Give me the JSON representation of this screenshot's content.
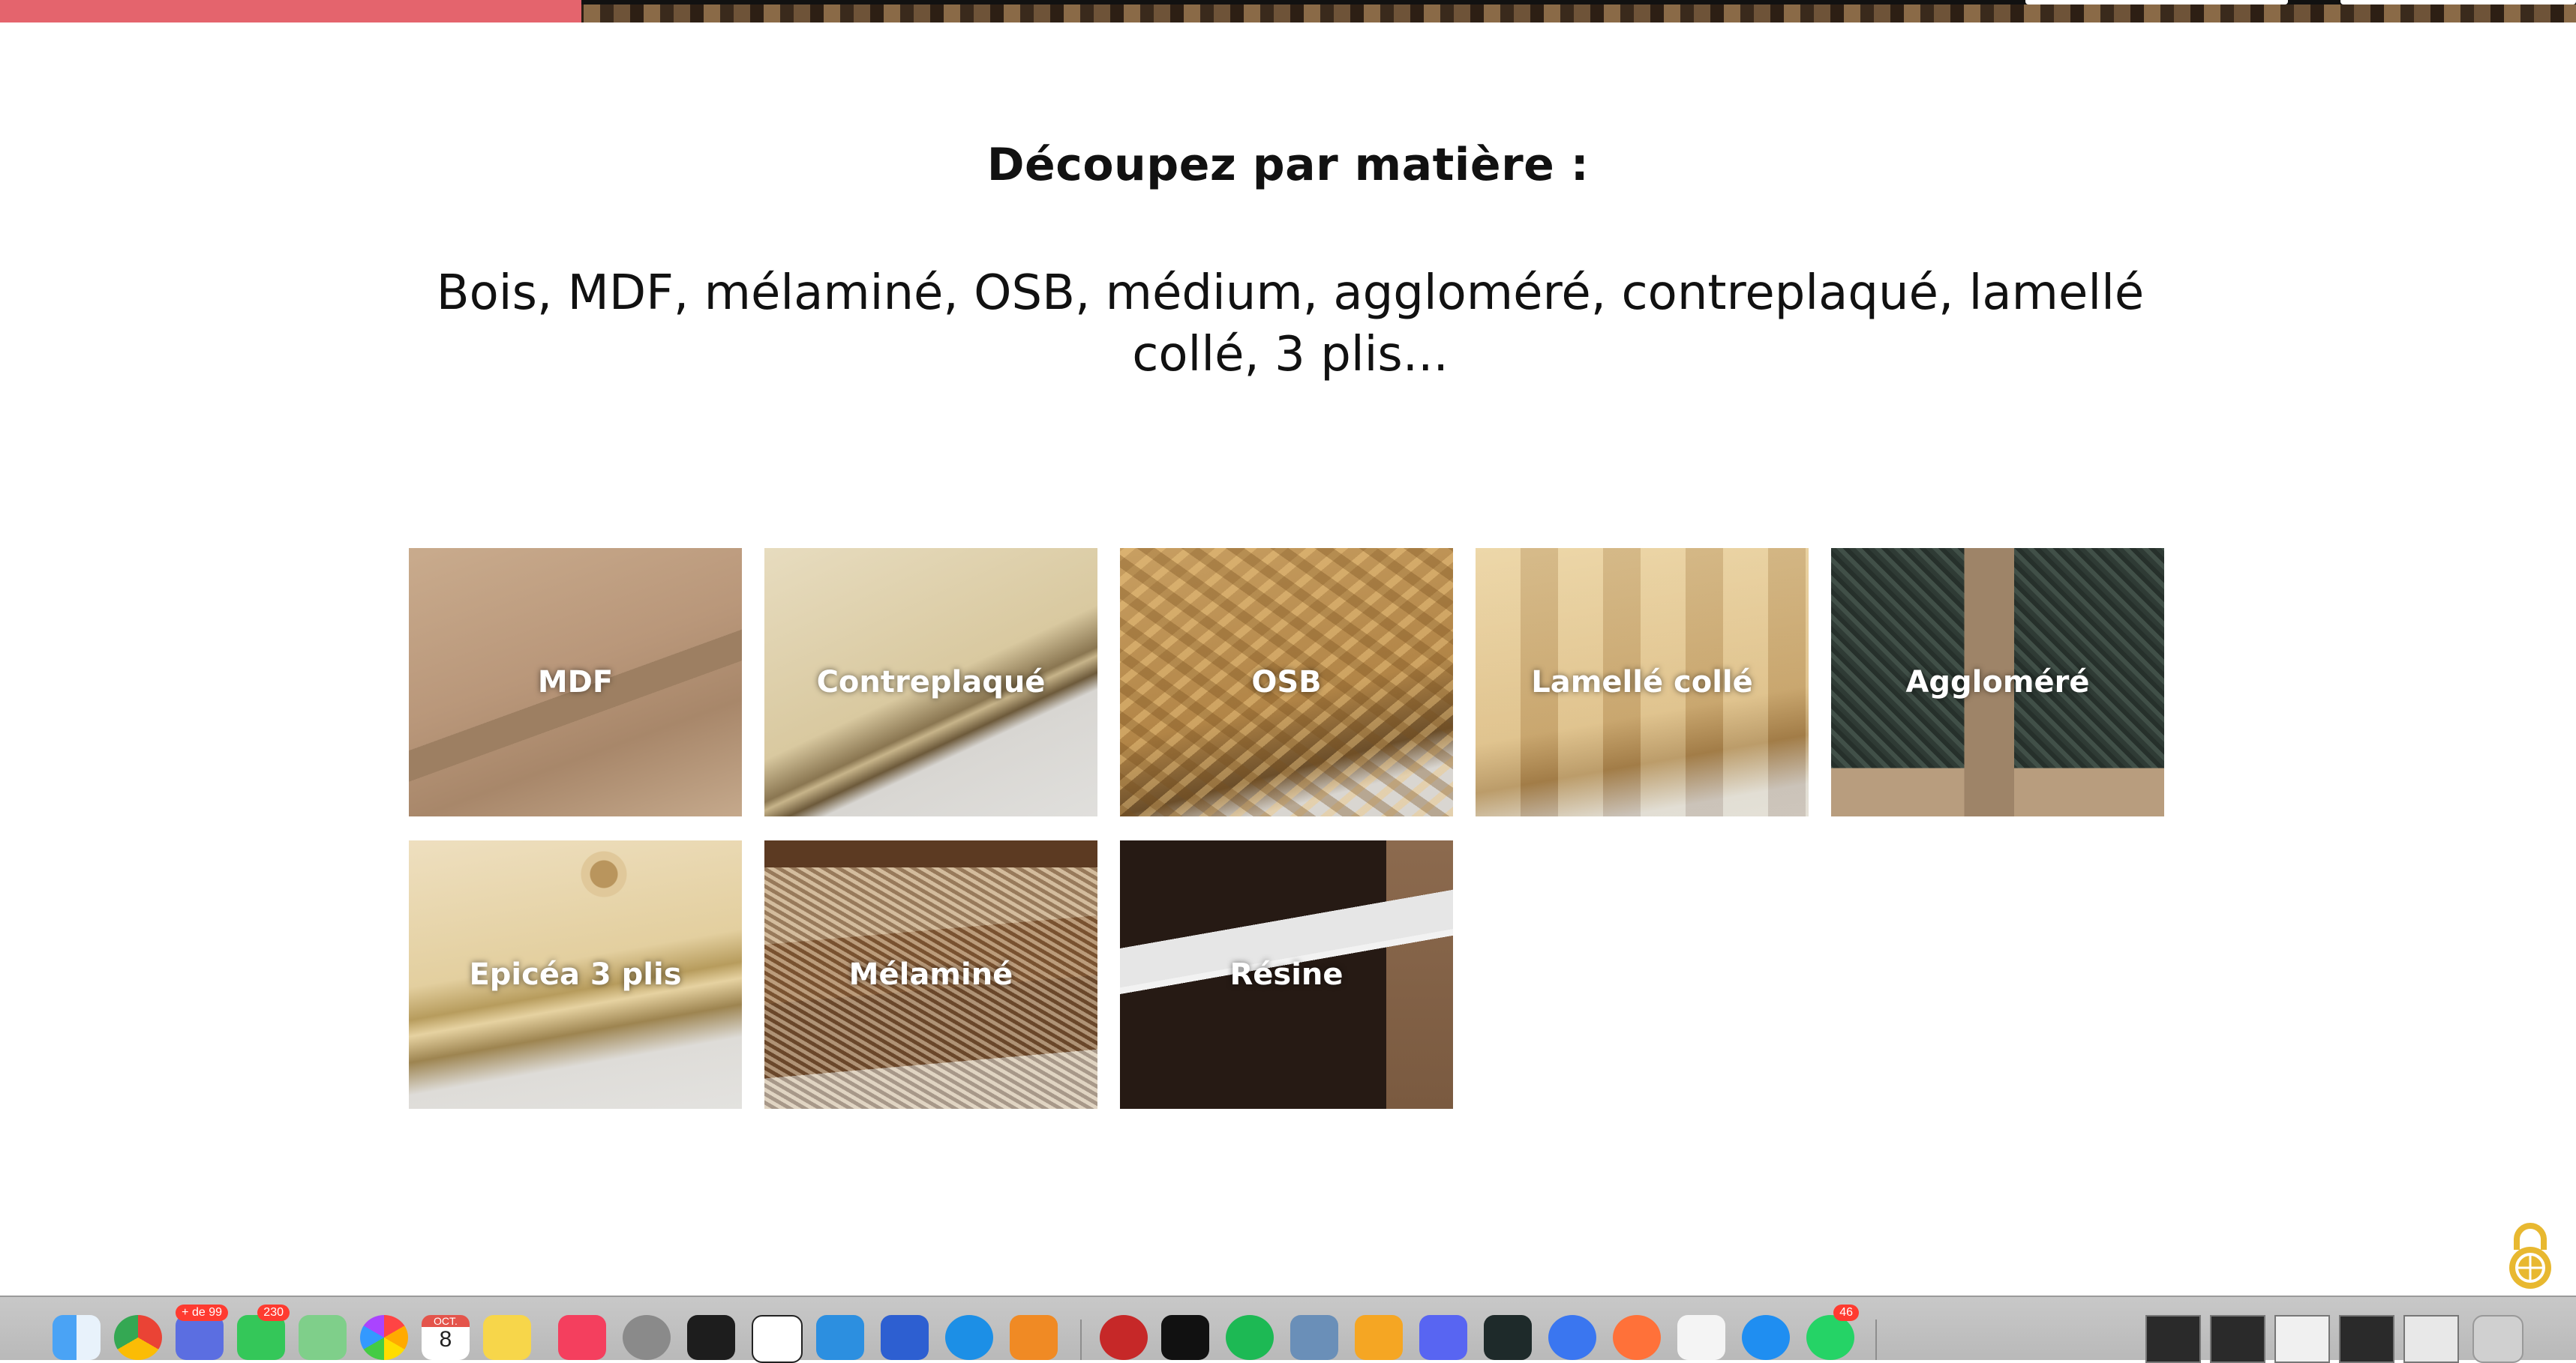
{
  "section": {
    "heading": "Découpez par matière :",
    "subtitle": "Bois, MDF, mélaminé, OSB, médium, aggloméré, contreplaqué, lamellé collé, 3 plis..."
  },
  "materials": [
    {
      "label": "MDF"
    },
    {
      "label": "Contreplaqué"
    },
    {
      "label": "OSB"
    },
    {
      "label": "Lamellé collé"
    },
    {
      "label": "Aggloméré"
    },
    {
      "label": "Epicéa 3 plis"
    },
    {
      "label": "Mélaminé"
    },
    {
      "label": "Résine"
    }
  ],
  "dock": {
    "badges": {
      "mail": "+ de 99",
      "messages": "230",
      "whatsapp": "46"
    },
    "calendar_month": "OCT.",
    "calendar_day": "8"
  },
  "colors": {
    "accent_red": "#e4646d",
    "lock_icon": "#e8b830"
  }
}
